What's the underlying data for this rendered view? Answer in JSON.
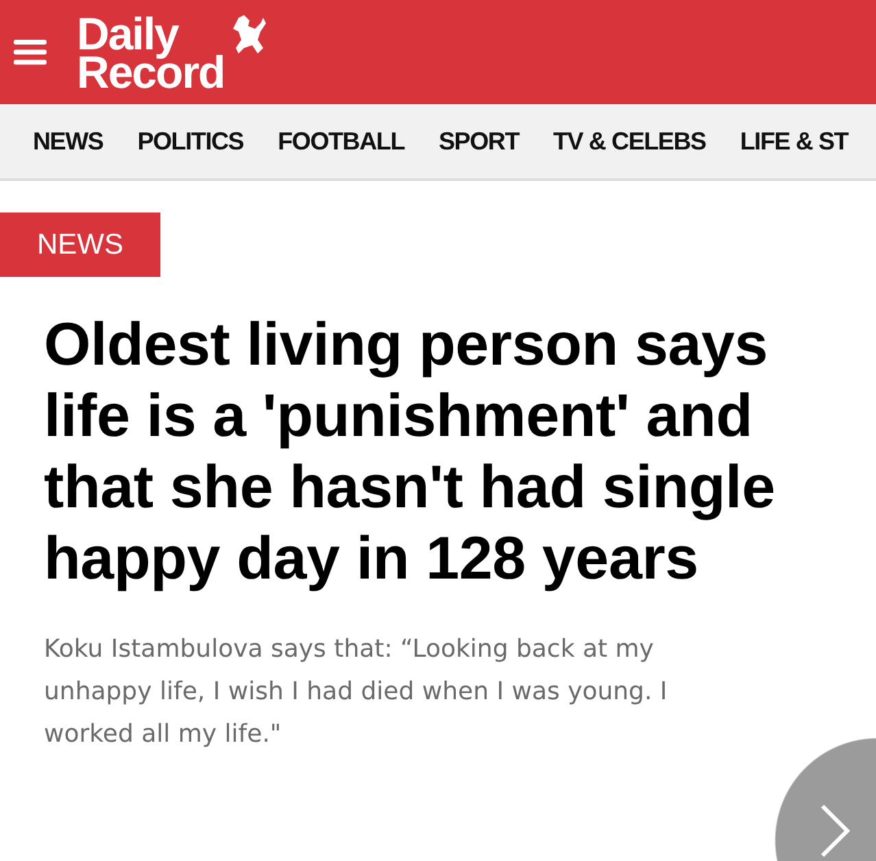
{
  "header": {
    "logo_lines": [
      "Daily",
      "Record"
    ]
  },
  "nav": {
    "items": [
      "NEWS",
      "POLITICS",
      "FOOTBALL",
      "SPORT",
      "TV & CELEBS",
      "LIFE & ST"
    ]
  },
  "article": {
    "section": "NEWS",
    "headline": "Oldest living person says life is a 'punishment' and that she hasn't had single happy day in 128 years",
    "standfirst": "Koku Istambulova says that: “Looking back at my unhappy life, I wish I had died when I was young. I worked all my life.\""
  }
}
